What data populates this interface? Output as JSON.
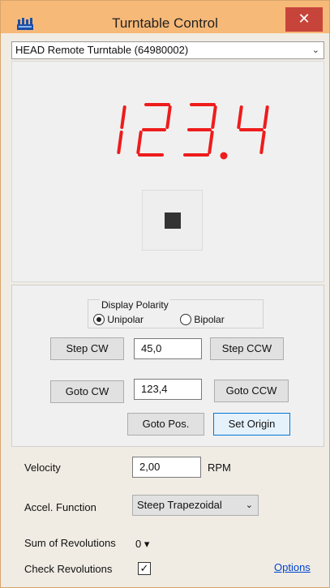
{
  "window": {
    "title": "Turntable Control",
    "close_glyph": "✕",
    "app_icon": "turntable-app-icon"
  },
  "device": {
    "selected": "HEAD Remote Turntable (64980002)",
    "chevron": "⌄"
  },
  "display": {
    "value": "123.4",
    "color": "#ee1c1c",
    "stop_icon": "stop-icon"
  },
  "polarity": {
    "title": "Display Polarity",
    "options": [
      "Unipolar",
      "Bipolar"
    ],
    "selected": "Unipolar"
  },
  "step": {
    "cw_label": "Step CW",
    "value": "45,0",
    "ccw_label": "Step CCW"
  },
  "goto": {
    "cw_label": "Goto CW",
    "value": "123,4",
    "ccw_label": "Goto CCW",
    "pos_label": "Goto Pos.",
    "set_origin_label": "Set Origin"
  },
  "velocity": {
    "label": "Velocity",
    "value": "2,00",
    "unit": "RPM"
  },
  "accel": {
    "label": "Accel. Function",
    "selected": "Steep Trapezoidal",
    "chevron": "⌄"
  },
  "revolutions": {
    "sum_label": "Sum of Revolutions",
    "sum_value": "0 ▾",
    "check_label": "Check Revolutions",
    "check_glyph": "✓",
    "checked": true
  },
  "options_link": "Options"
}
